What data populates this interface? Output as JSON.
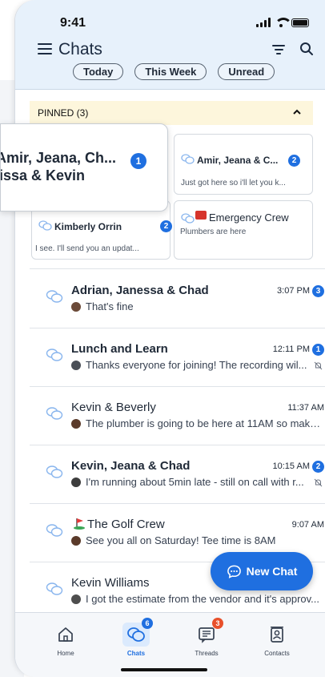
{
  "status": {
    "time": "9:41"
  },
  "header": {
    "title": "Chats",
    "chips": [
      "Today",
      "This Week",
      "Unread"
    ]
  },
  "pinned": {
    "header": "PINNED (3)",
    "popup": {
      "line1": "Amir, Jeana, Ch...",
      "line2": "issa & Kevin",
      "badge": "1"
    },
    "cards": [
      {
        "name": "Amir, Jeana & C...",
        "preview": "Just got here so i'll let you k...",
        "badge": "2"
      },
      {
        "name": "Kimberly Orrin",
        "preview": "I see.  I'll send you an updat...",
        "badge": "2"
      },
      {
        "name": "Emergency Crew",
        "preview": "Plumbers are here",
        "badge": ""
      }
    ]
  },
  "chats": [
    {
      "name": "Adrian, Janessa & Chad",
      "time": "3:07 PM",
      "preview": "That's fine",
      "badge": "3",
      "bold": true,
      "muted": false
    },
    {
      "name": "Lunch and Learn",
      "time": "12:11 PM",
      "preview": "Thanks everyone for joining! The recording wil...",
      "badge": "1",
      "bold": true,
      "muted": true
    },
    {
      "name": "Kevin & Beverly",
      "time": "11:37 AM",
      "preview": "The plumber is going to be here at 11AM so make...",
      "badge": "",
      "bold": false,
      "muted": false
    },
    {
      "name": "Kevin, Jeana & Chad",
      "time": "10:15 AM",
      "preview": "I'm running about 5min late - still on call with r...",
      "badge": "2",
      "bold": true,
      "muted": true
    },
    {
      "name": "The Golf Crew",
      "time": "9:07 AM",
      "preview": "See you all on Saturday! Tee time is 8AM",
      "badge": "",
      "bold": false,
      "muted": false
    },
    {
      "name": "Kevin Williams",
      "time": "",
      "preview": "I got the estimate from the vendor and it's approv...",
      "badge": "",
      "bold": false,
      "muted": false
    }
  ],
  "fab": {
    "label": "New Chat"
  },
  "tabs": [
    {
      "label": "Home",
      "badge": ""
    },
    {
      "label": "Chats",
      "badge": "6"
    },
    {
      "label": "Threads",
      "badge": "3"
    },
    {
      "label": "Contacts",
      "badge": ""
    }
  ],
  "colors": {
    "accent": "#1f6fe0",
    "header_bg": "#e7f1fb",
    "pinned_bg": "#fdf6dc",
    "threads_badge": "#e8502b"
  }
}
